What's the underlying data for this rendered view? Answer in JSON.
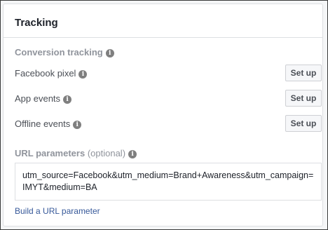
{
  "tracking": {
    "title": "Tracking",
    "conversion": {
      "label": "Conversion tracking",
      "rows": [
        {
          "label": "Facebook pixel",
          "button": "Set up"
        },
        {
          "label": "App events",
          "button": "Set up"
        },
        {
          "label": "Offline events",
          "button": "Set up"
        }
      ]
    },
    "url_params": {
      "label": "URL parameters",
      "optional": "(optional)",
      "value": "utm_source=Facebook&utm_medium=Brand+Awareness&utm_campaign=IMYT&medium=BA",
      "link": "Build a URL parameter"
    },
    "info_icon": "info-icon",
    "colors": {
      "link": "#365899",
      "section_label": "#90949c",
      "card_border": "#dddfe2"
    }
  }
}
